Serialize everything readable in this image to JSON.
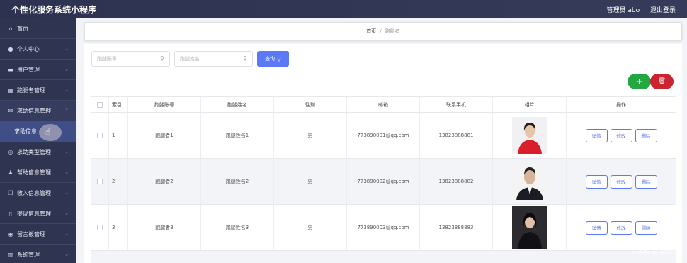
{
  "app_title": "个性化服务系统小程序",
  "header": {
    "admin_label": "管理员 abo",
    "logout_label": "退出登录"
  },
  "sidebar": {
    "items": [
      {
        "label": "首页",
        "icon": "home-icon"
      },
      {
        "label": "个人中心",
        "icon": "user-icon"
      },
      {
        "label": "用户管理",
        "icon": "folder-icon"
      },
      {
        "label": "跑腿者管理",
        "icon": "grid-icon"
      },
      {
        "label": "求助信息管理",
        "icon": "mail-icon"
      },
      {
        "label": "求助类型管理",
        "icon": "compass-icon"
      },
      {
        "label": "帮助信息管理",
        "icon": "person-icon"
      },
      {
        "label": "收入信息管理",
        "icon": "copy-icon"
      },
      {
        "label": "提现信息管理",
        "icon": "phone-icon"
      },
      {
        "label": "留言板管理",
        "icon": "location-icon"
      },
      {
        "label": "系统管理",
        "icon": "chart-icon"
      }
    ],
    "submenu_label": "求助信息"
  },
  "breadcrumb": {
    "home": "首页",
    "sep": "/",
    "current": "跑腿者"
  },
  "search": {
    "account_placeholder": "跑腿账号",
    "name_placeholder": "跑腿姓名",
    "button_label": "查询"
  },
  "actions": {
    "add_icon": "plus-icon",
    "delete_icon": "trash-icon"
  },
  "table": {
    "columns": [
      "",
      "索引",
      "跑腿账号",
      "跑腿姓名",
      "性别",
      "邮箱",
      "联系手机",
      "相片",
      "操作"
    ],
    "rows": [
      {
        "index": "1",
        "account": "跑腿者1",
        "name": "跑腿姓名1",
        "gender": "男",
        "email": "773890001@qq.com",
        "phone": "13823888881"
      },
      {
        "index": "2",
        "account": "跑腿者2",
        "name": "跑腿姓名2",
        "gender": "男",
        "email": "773890002@qq.com",
        "phone": "13823888882"
      },
      {
        "index": "3",
        "account": "跑腿者3",
        "name": "跑腿姓名3",
        "gender": "男",
        "email": "773890003@qq.com",
        "phone": "13823888883"
      }
    ],
    "op_labels": {
      "detail": "详情",
      "edit": "修改",
      "delete": "删除"
    }
  },
  "watermark": "CSDN @kxbysj",
  "colors": {
    "primary": "#5b78f5",
    "add": "#23a841",
    "delete": "#c9242f",
    "sidebar": "#2f3451"
  }
}
